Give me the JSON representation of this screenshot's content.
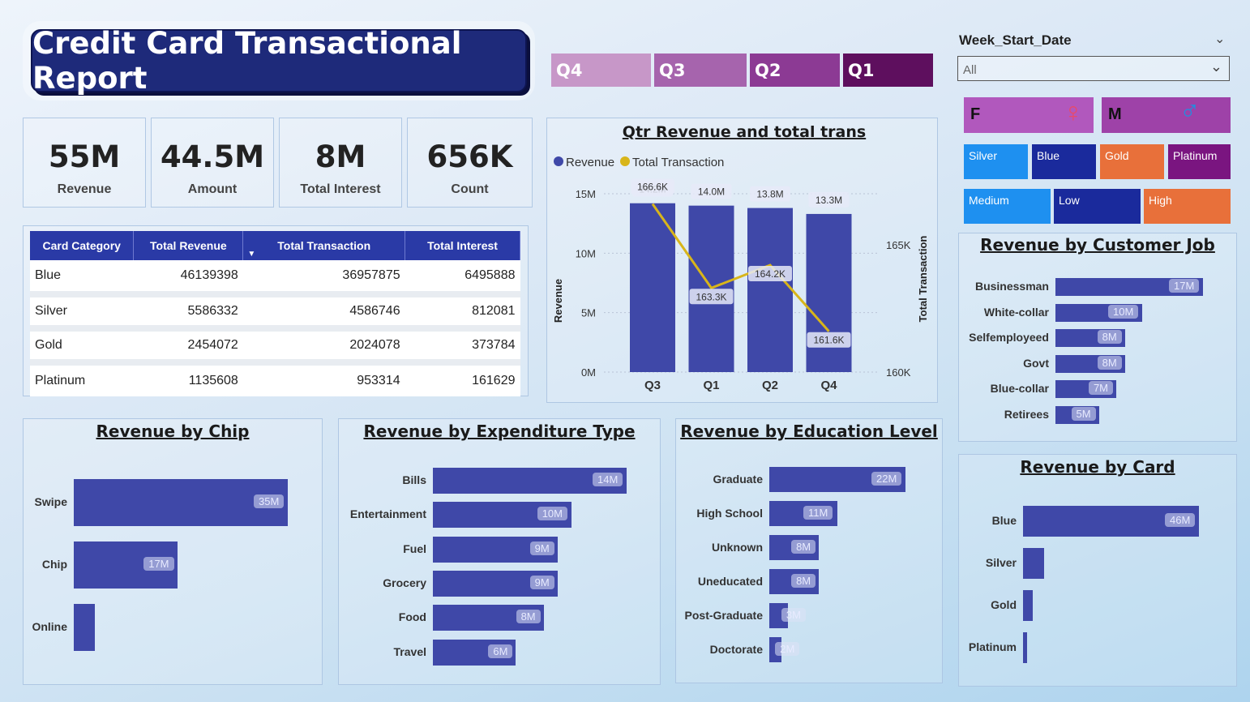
{
  "title": "Credit Card Transactional Report",
  "kpis": [
    {
      "value": "55M",
      "label": "Revenue"
    },
    {
      "value": "44.5M",
      "label": "Amount"
    },
    {
      "value": "8M",
      "label": "Total Interest"
    },
    {
      "value": "656K",
      "label": "Count"
    }
  ],
  "quarters": [
    {
      "label": "Q4",
      "color": "#c797c8"
    },
    {
      "label": "Q3",
      "color": "#a664ad"
    },
    {
      "label": "Q2",
      "color": "#8c3a94"
    },
    {
      "label": "Q1",
      "color": "#5e0f5e"
    }
  ],
  "slicer": {
    "label": "Week_Start_Date",
    "value": "All"
  },
  "gender": [
    {
      "label": "F",
      "icon": "female-icon",
      "glyph": "♀",
      "glyph_color": "#e84a6a"
    },
    {
      "label": "M",
      "icon": "male-icon",
      "glyph": "♂",
      "glyph_color": "#1e90e0"
    }
  ],
  "card_filters": [
    {
      "label": "Silver",
      "color": "#1e90f0"
    },
    {
      "label": "Blue",
      "color": "#1a2a9c"
    },
    {
      "label": "Gold",
      "color": "#e8703a"
    },
    {
      "label": "Platinum",
      "color": "#7a1580"
    }
  ],
  "level_filters": [
    {
      "label": "Medium",
      "color": "#1e90f0"
    },
    {
      "label": "Low",
      "color": "#1a2a9c"
    },
    {
      "label": "High",
      "color": "#e8703a"
    }
  ],
  "table": {
    "headers": [
      "Card Category",
      "Total Revenue",
      "Total Transaction",
      "Total Interest"
    ],
    "rows": [
      [
        "Blue",
        "46139398",
        "36957875",
        "6495888"
      ],
      [
        "Silver",
        "5586332",
        "4586746",
        "812081"
      ],
      [
        "Gold",
        "2454072",
        "2024078",
        "373784"
      ],
      [
        "Platinum",
        "1135608",
        "953314",
        "161629"
      ]
    ]
  },
  "colors": {
    "bar": "#3f48a8",
    "line": "#d8b51a",
    "header": "#2a3aa6"
  },
  "chart_data": [
    {
      "type": "bar",
      "title": "Qtr Revenue and total trans",
      "legend": [
        "Revenue",
        "Total Transaction"
      ],
      "legend_position": "top-left",
      "categories": [
        "Q3",
        "Q1",
        "Q2",
        "Q4"
      ],
      "ylabel": "Revenue",
      "y2label": "Total Transaction",
      "yticks": [
        "15M",
        "10M",
        "5M",
        "0M"
      ],
      "y2ticks": [
        "165K",
        "160K"
      ],
      "ylim": [
        0,
        15000000
      ],
      "y2lim": [
        160000,
        167000
      ],
      "series": [
        {
          "name": "Revenue",
          "type": "bar",
          "values": [
            14200000,
            14000000,
            13800000,
            13300000
          ],
          "labels": [
            "14.2M",
            "14.0M",
            "13.8M",
            "13.3M"
          ]
        },
        {
          "name": "Total Transaction",
          "type": "line",
          "values": [
            166600,
            163300,
            164200,
            161600
          ],
          "labels": [
            "166.6K",
            "163.3K",
            "164.2K",
            "161.6K"
          ]
        }
      ]
    },
    {
      "type": "bar",
      "orientation": "horizontal",
      "title": "Revenue by Customer Job",
      "categories": [
        "Businessman",
        "White-collar",
        "Selfemployeed",
        "Govt",
        "Blue-collar",
        "Retirees"
      ],
      "values": [
        17,
        10,
        8,
        8,
        7,
        5
      ],
      "labels": [
        "17M",
        "10M",
        "8M",
        "8M",
        "7M",
        "5M"
      ],
      "unit": "M"
    },
    {
      "type": "bar",
      "orientation": "horizontal",
      "title": "Revenue by Chip",
      "categories": [
        "Swipe",
        "Chip",
        "Online"
      ],
      "values": [
        35,
        17,
        3.5
      ],
      "labels": [
        "35M",
        "17M",
        ""
      ],
      "unit": "M"
    },
    {
      "type": "bar",
      "orientation": "horizontal",
      "title": "Revenue by Expenditure Type",
      "categories": [
        "Bills",
        "Entertainment",
        "Fuel",
        "Grocery",
        "Food",
        "Travel"
      ],
      "values": [
        14,
        10,
        9,
        9,
        8,
        6
      ],
      "labels": [
        "14M",
        "10M",
        "9M",
        "9M",
        "8M",
        "6M"
      ],
      "unit": "M"
    },
    {
      "type": "bar",
      "orientation": "horizontal",
      "title": "Revenue by Education Level",
      "categories": [
        "Graduate",
        "High School",
        "Unknown",
        "Uneducated",
        "Post-Graduate",
        "Doctorate"
      ],
      "values": [
        22,
        11,
        8,
        8,
        3,
        2
      ],
      "labels": [
        "22M",
        "11M",
        "8M",
        "8M",
        "3M",
        "2M"
      ],
      "unit": "M"
    },
    {
      "type": "bar",
      "orientation": "horizontal",
      "title": "Revenue by Card",
      "categories": [
        "Blue",
        "Silver",
        "Gold",
        "Platinum"
      ],
      "values": [
        46,
        5.6,
        2.5,
        1.1
      ],
      "labels": [
        "46M",
        "",
        "",
        ""
      ],
      "unit": "M"
    }
  ]
}
